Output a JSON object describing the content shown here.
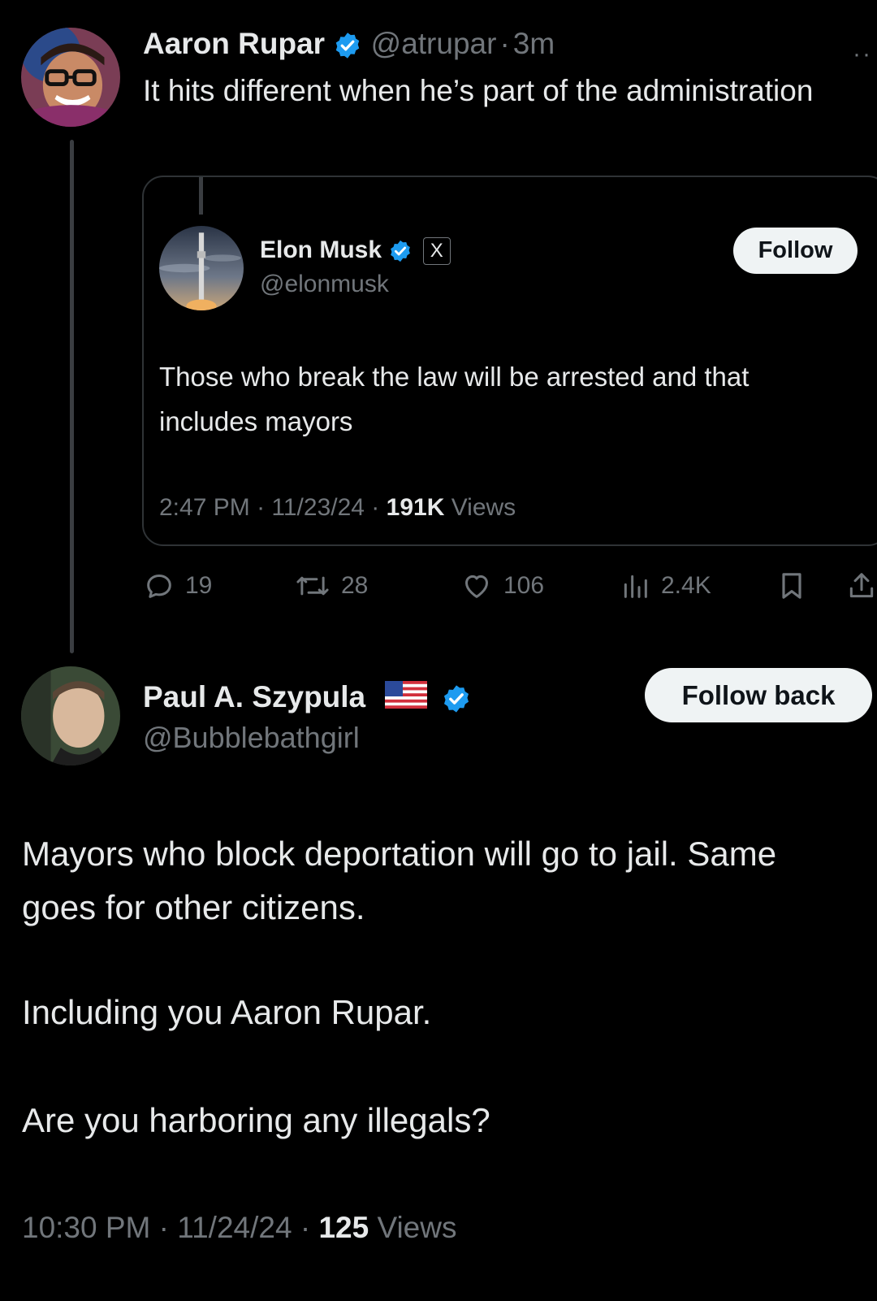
{
  "tweet": {
    "author": {
      "name": "Aaron Rupar",
      "handle": "@atrupar",
      "time": "3m",
      "avatar": "person-avatar"
    },
    "text": "It hits different when he’s part of the administration",
    "more_label": "··",
    "quoted": {
      "author": {
        "name": "Elon Musk",
        "handle": "@elonmusk",
        "affiliation_badge": "X",
        "avatar": "rocket-avatar"
      },
      "follow_label": "Follow",
      "text": "Those who break the law will be arrested and that includes mayors",
      "time": "2:47 PM",
      "date": "11/23/24",
      "views_count": "191K",
      "views_label": "Views"
    },
    "actions": {
      "replies": "19",
      "reposts": "28",
      "likes": "106",
      "views": "2.4K"
    }
  },
  "reply": {
    "author": {
      "name": "Paul A. Szypula",
      "handle": "@Bubblebathgirl",
      "flag": "us-flag",
      "avatar": "person-avatar"
    },
    "follow_back_label": "Follow back",
    "paragraphs": [
      "Mayors who block deportation will go to jail. Same goes for other citizens.",
      "Including you Aaron Rupar.",
      "Are you harboring any illegals?"
    ],
    "time": "10:30 PM",
    "date": "11/24/24",
    "views_count": "125",
    "views_label": "Views"
  },
  "colors": {
    "background": "#000000",
    "text": "#e7e9ea",
    "muted": "#71767b",
    "verified": "#1d9bf0",
    "button_bg": "#eff3f4"
  }
}
